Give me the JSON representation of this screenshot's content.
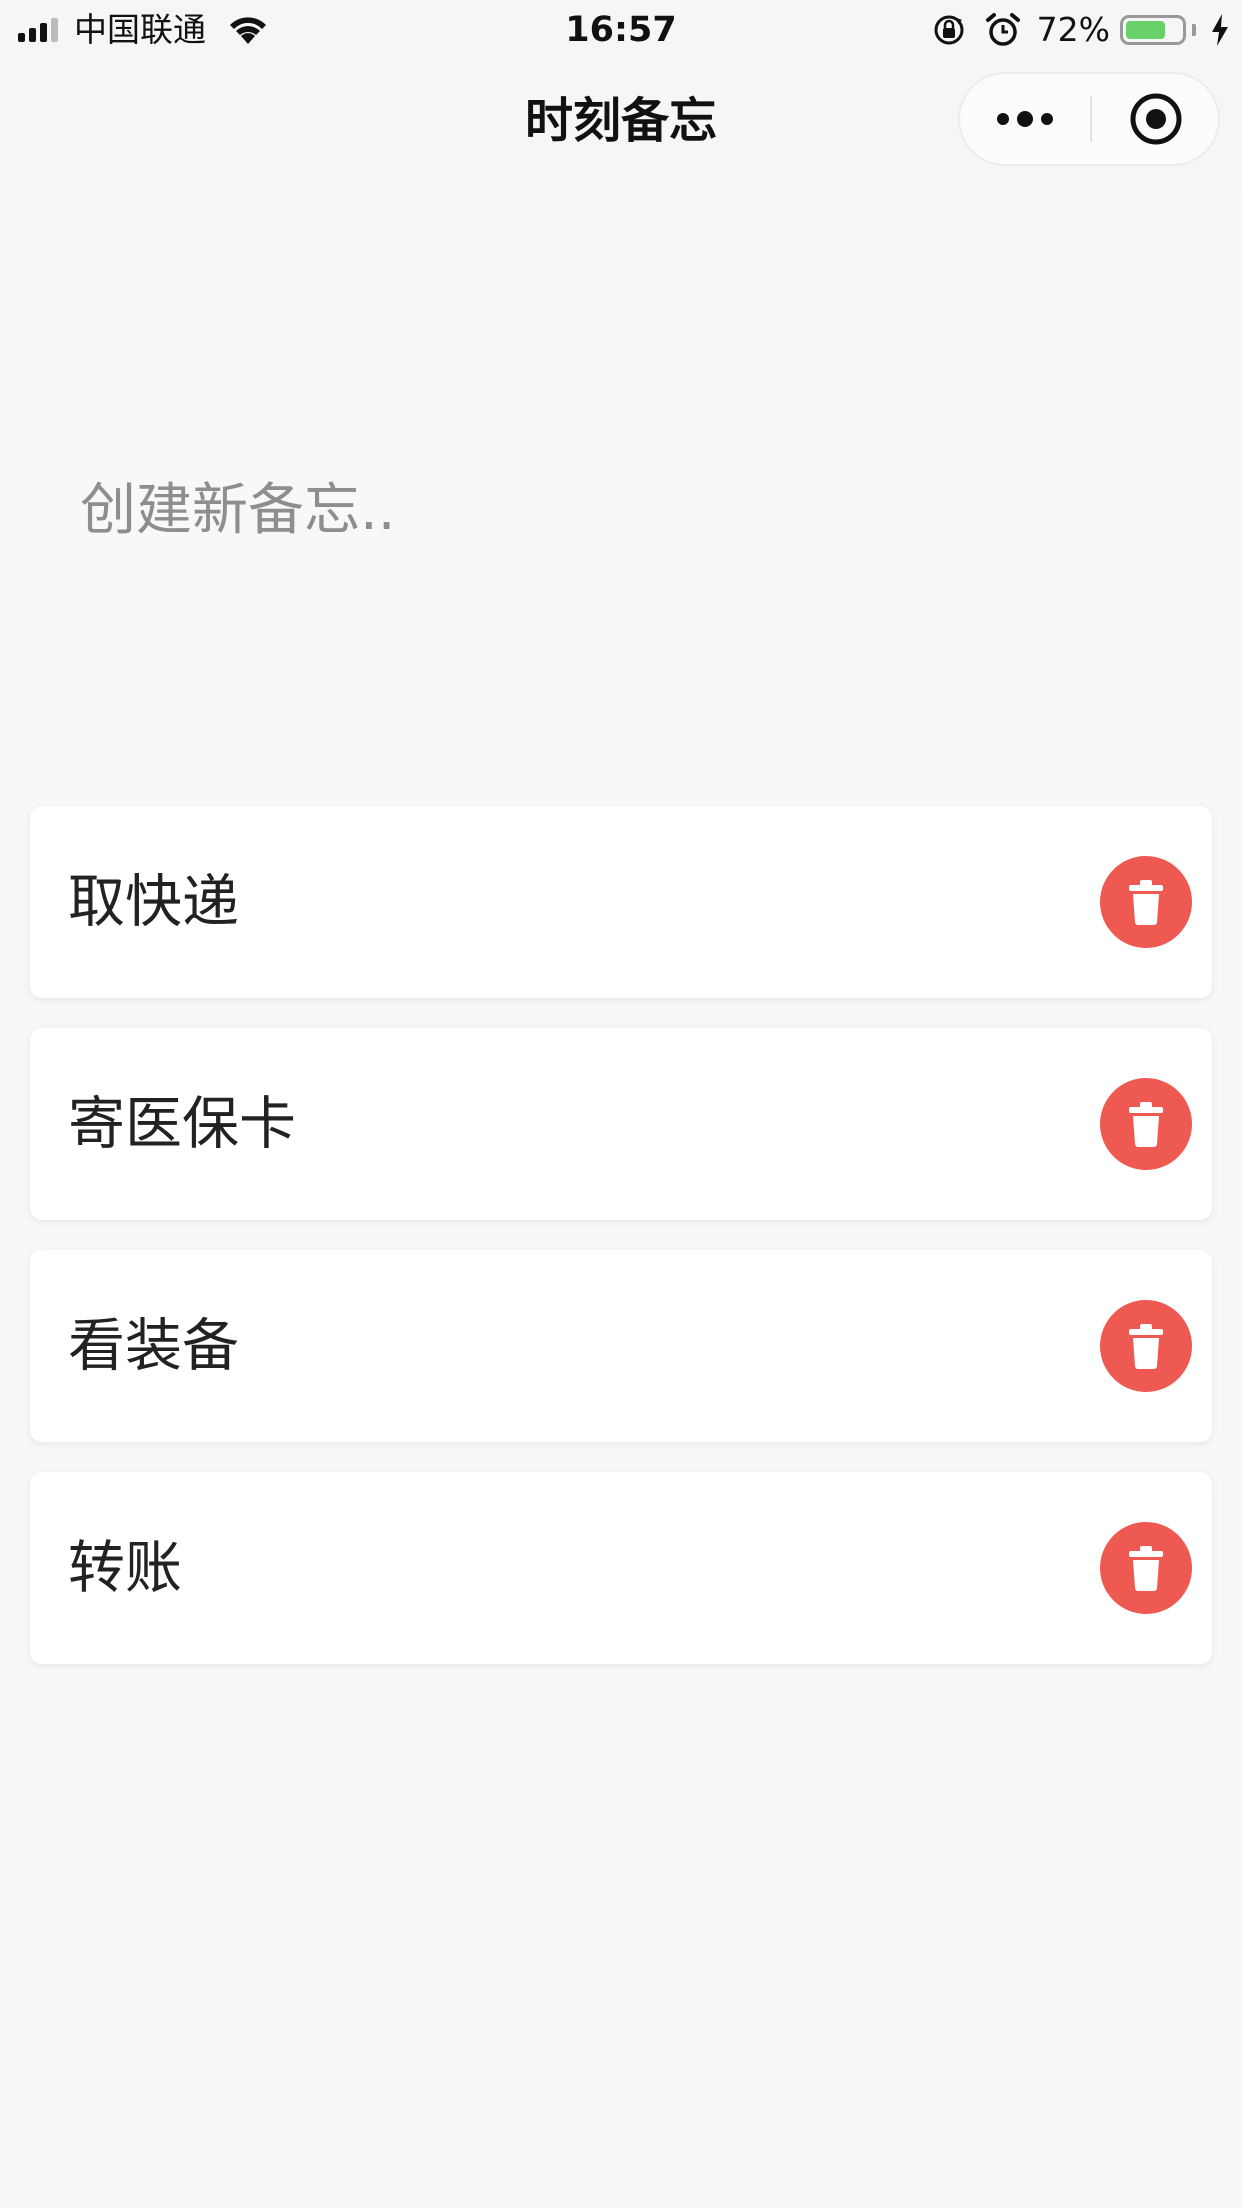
{
  "status_bar": {
    "carrier": "中国联通",
    "time": "16:57",
    "battery_percent": "72%",
    "battery_level": 0.72,
    "icons": [
      "signal-icon",
      "wifi-icon",
      "rotation-lock-icon",
      "alarm-icon",
      "battery-icon",
      "charging-icon"
    ]
  },
  "nav": {
    "title": "时刻备忘",
    "icons": [
      "more-icon",
      "close-capsule-icon"
    ]
  },
  "new_memo": {
    "placeholder": "创建新备忘..",
    "value": ""
  },
  "memos": [
    {
      "text": "取快递",
      "icon": "trash-icon"
    },
    {
      "text": "寄医保卡",
      "icon": "trash-icon"
    },
    {
      "text": "看装备",
      "icon": "trash-icon"
    },
    {
      "text": "转账",
      "icon": "trash-icon"
    }
  ],
  "colors": {
    "background": "#f8f8f8",
    "card": "#ffffff",
    "delete_button": "#ee5a52",
    "battery_fill": "#6ad06a",
    "placeholder": "#8e8e8e"
  }
}
